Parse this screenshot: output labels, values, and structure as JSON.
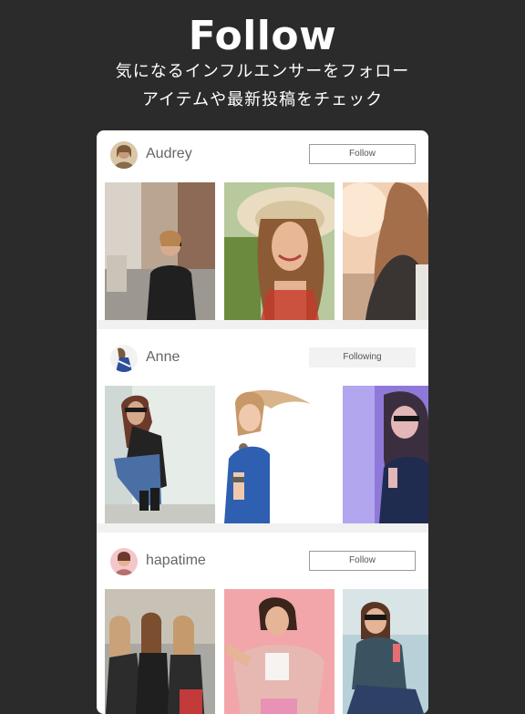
{
  "hero": {
    "title": "Follow",
    "subtitle_line1": "気になるインフルエンサーをフォロー",
    "subtitle_line2": "アイテムや最新投稿をチェック"
  },
  "feed": {
    "users": [
      {
        "name": "Audrey",
        "button_label": "Follow",
        "following": false,
        "avatar_colors": [
          "#d9c7a8",
          "#8a6a4a"
        ],
        "photos": [
          {
            "scene": "woman-street-black-sweater",
            "colors": [
              "#b9a592",
              "#2b2b2b"
            ]
          },
          {
            "scene": "woman-straw-hat-smiling",
            "colors": [
              "#d8cba8",
              "#c98a62"
            ]
          },
          {
            "scene": "woman-back-sunlight",
            "colors": [
              "#f1d0b4",
              "#3a3533"
            ]
          }
        ]
      },
      {
        "name": "Anne",
        "button_label": "Following",
        "following": true,
        "avatar_colors": [
          "#f2f2f2",
          "#2f4d9a"
        ],
        "photos": [
          {
            "scene": "woman-sunglasses-white-wall",
            "colors": [
              "#e6ece8",
              "#232323"
            ]
          },
          {
            "scene": "woman-blue-top-hair-motion",
            "colors": [
              "#ffffff",
              "#2f5fb0"
            ]
          },
          {
            "scene": "woman-sunglasses-purple-light",
            "colors": [
              "#8f79d8",
              "#1f2c4f"
            ]
          }
        ]
      },
      {
        "name": "hapatime",
        "button_label": "Follow",
        "following": false,
        "avatar_colors": [
          "#f3c6cc",
          "#b76d6d"
        ],
        "photos": [
          {
            "scene": "friends-leather-jackets",
            "colors": [
              "#a9a8a2",
              "#2c2c2c"
            ]
          },
          {
            "scene": "woman-pink-fur-coat",
            "colors": [
              "#f2a6aa",
              "#e7b8b2"
            ]
          },
          {
            "scene": "woman-sitting-drink",
            "colors": [
              "#b8d0d8",
              "#3a5360"
            ]
          }
        ]
      }
    ]
  }
}
